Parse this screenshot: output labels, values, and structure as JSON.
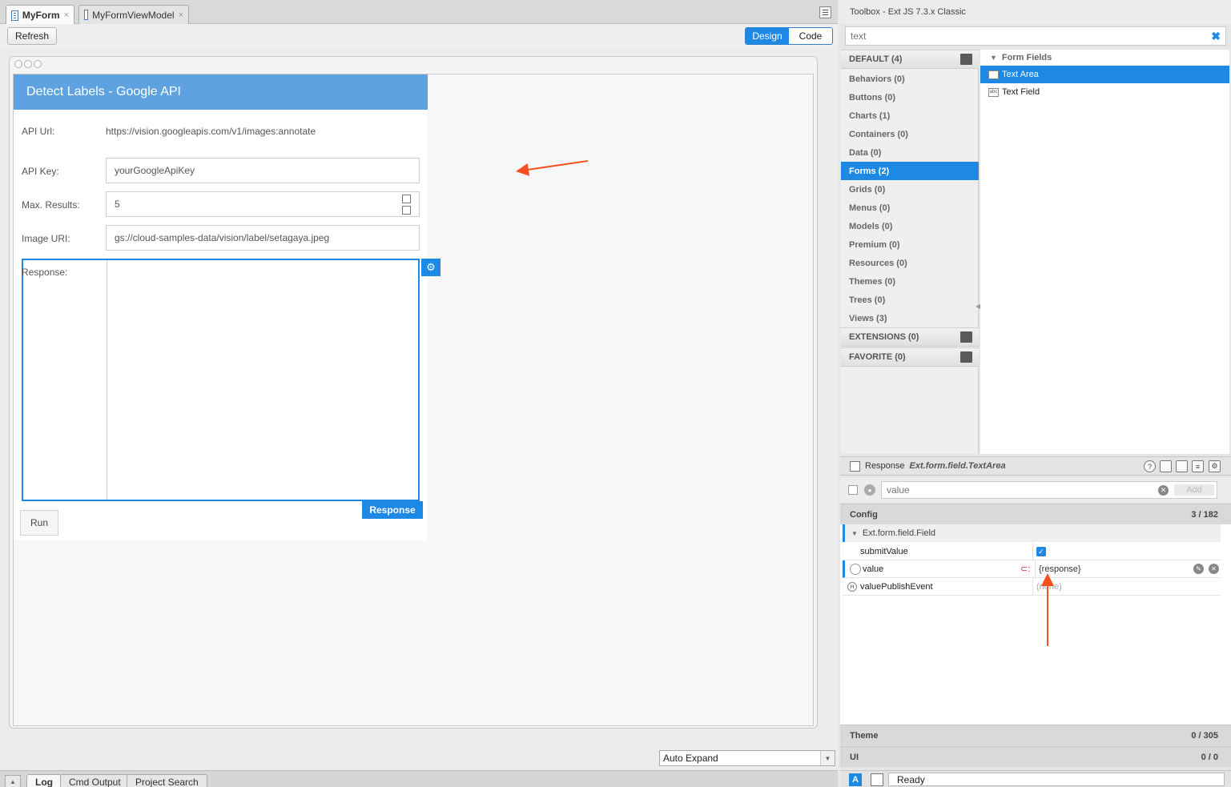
{
  "tabs": [
    {
      "label": "MyForm",
      "close": "×"
    },
    {
      "label": "MyFormViewModel",
      "close": "×"
    }
  ],
  "toolbar": {
    "refresh": "Refresh",
    "design": "Design",
    "code": "Code"
  },
  "form": {
    "title": "Detect Labels - Google API",
    "api_url_label": "API Url:",
    "api_url_value": "https://vision.googleapis.com/v1/images:annotate",
    "api_key_label": "API Key:",
    "api_key_value": "yourGoogleApiKey",
    "max_results_label": "Max. Results:",
    "max_results_value": "5",
    "image_uri_label": "Image URI:",
    "image_uri_value": "gs://cloud-samples-data/vision/label/setagaya.jpeg",
    "response_label": "Response:",
    "response_badge": "Response",
    "run": "Run"
  },
  "bottom": {
    "auto_expand": "Auto Expand"
  },
  "log_tabs": [
    "Log",
    "Cmd Output",
    "Project Search"
  ],
  "toolbox": {
    "title": "Toolbox - Ext JS 7.3.x Classic",
    "search": "text",
    "default_header": "DEFAULT (4)",
    "categories": [
      "Behaviors (0)",
      "Buttons (0)",
      "Charts (1)",
      "Containers (0)",
      "Data (0)",
      "Forms (2)",
      "Grids (0)",
      "Menus (0)",
      "Models (0)",
      "Premium (0)",
      "Resources (0)",
      "Themes (0)",
      "Trees (0)",
      "Views (3)"
    ],
    "extensions_header": "EXTENSIONS (0)",
    "favorite_header": "FAVORITE (0)",
    "group": "Form Fields",
    "components": [
      "Text Area",
      "Text Field"
    ],
    "component_icons": [
      "",
      "abc"
    ]
  },
  "inspector": {
    "name": "Response",
    "class": "Ext.form.field.TextArea",
    "filter": "value",
    "add": "Add",
    "config_label": "Config",
    "config_count": "3 / 182",
    "group": "Ext.form.field.Field",
    "rows": [
      {
        "name": "submitValue",
        "value": "✓"
      },
      {
        "name": "value",
        "value": "{response}"
      },
      {
        "name": "valuePublishEvent",
        "value": "(none)"
      }
    ],
    "theme_label": "Theme",
    "theme_count": "0 / 305",
    "ui_label": "UI",
    "ui_count": "0 / 0"
  },
  "status": {
    "a": "A",
    "text": "Ready"
  },
  "colors": {
    "accent": "#1e88e5",
    "header": "#5fa2e2",
    "arrow": "#f4511e"
  }
}
